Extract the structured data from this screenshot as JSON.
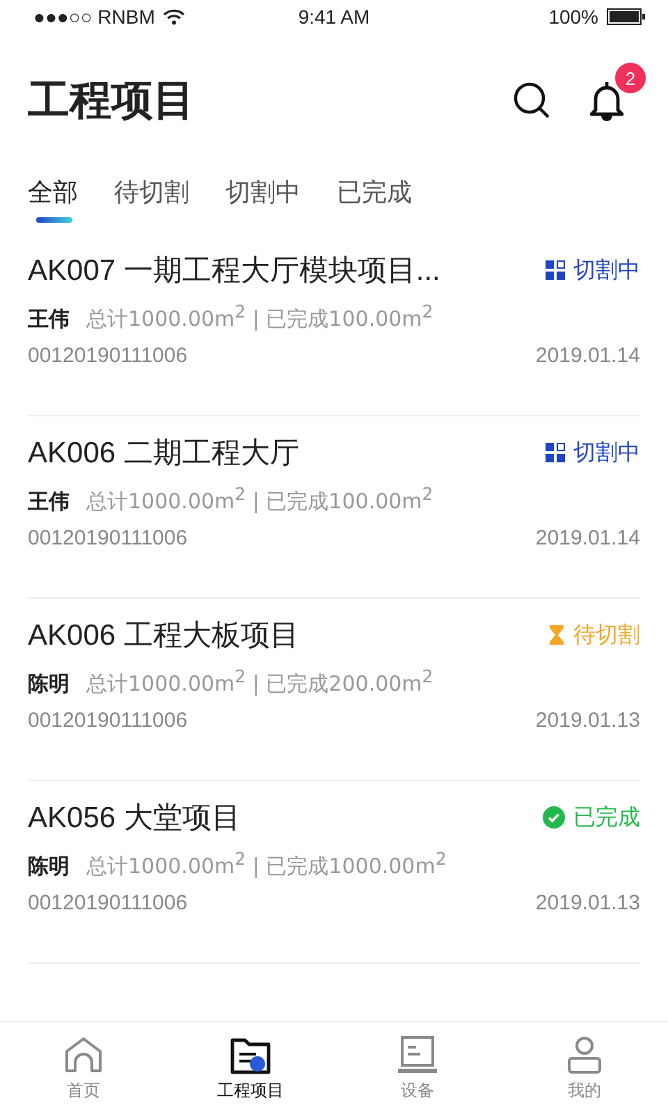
{
  "status_bar": {
    "carrier": "●●●○○ RNBM",
    "time": "9:41 AM",
    "battery": "100%"
  },
  "header": {
    "title": "工程项目",
    "notification_count": "2"
  },
  "tabs": [
    {
      "label": "全部",
      "selected": true
    },
    {
      "label": "待切割",
      "selected": false
    },
    {
      "label": "切割中",
      "selected": false
    },
    {
      "label": "已完成",
      "selected": false
    }
  ],
  "projects": [
    {
      "title": "AK007 一期工程大厅模块项目...",
      "status": {
        "kind": "cutting",
        "label": "切割中",
        "color": "#1f45c4"
      },
      "owner": "王伟",
      "summary": "总计1000.00m$^{2}$ | 已完成100.00m$^{2}$",
      "code": "00120190111006",
      "date": "2019.01.14"
    },
    {
      "title": "AK006 二期工程大厅",
      "status": {
        "kind": "cutting",
        "label": "切割中",
        "color": "#1f45c4"
      },
      "owner": "王伟",
      "summary": "总计1000.00m$^{2}$ | 已完成100.00m$^{2}$",
      "code": "00120190111006",
      "date": "2019.01.14"
    },
    {
      "title": "AK006 工程大板项目",
      "status": {
        "kind": "pending",
        "label": "待切割",
        "color": "#f5a623"
      },
      "owner": "陈明",
      "summary": "总计1000.00m$^{2}$ | 已完成200.00m$^{2}$",
      "code": "00120190111006",
      "date": "2019.01.13"
    },
    {
      "title": "AK056 大堂项目",
      "status": {
        "kind": "done",
        "label": "已完成",
        "color": "#22b94c"
      },
      "owner": "陈明",
      "summary": "总计1000.00m$^{2}$ | 已完成1000.00m$^{2}$",
      "code": "00120190111006",
      "date": "2019.01.13"
    }
  ],
  "bottom_nav": [
    {
      "kind": "home",
      "label": "首页",
      "selected": false
    },
    {
      "kind": "projects",
      "label": "工程项目",
      "selected": true
    },
    {
      "kind": "devices",
      "label": "设备",
      "selected": false
    },
    {
      "kind": "profile",
      "label": "我的",
      "selected": false
    }
  ]
}
